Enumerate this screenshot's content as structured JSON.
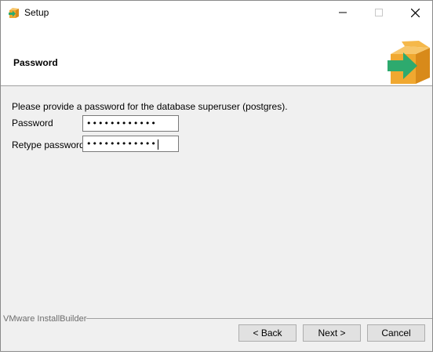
{
  "window": {
    "title": "Setup",
    "icons": [
      "setup-app-icon",
      "minimize-icon",
      "maximize-icon",
      "close-icon"
    ]
  },
  "header": {
    "title": "Password",
    "logo_icon": "installer-box-arrow-icon"
  },
  "main": {
    "intro": "Please provide a password for the database superuser (postgres).",
    "fields": [
      {
        "label": "Password",
        "value": "••••••••••••"
      },
      {
        "label": "Retype password",
        "value": "••••••••••••"
      }
    ]
  },
  "footer": {
    "brand": "VMware InstallBuilder",
    "buttons": {
      "back": "< Back",
      "next": "Next >",
      "cancel": "Cancel"
    }
  },
  "colors": {
    "logo_orange": "#f0a830",
    "logo_green": "#2daa6e",
    "window_bg": "#f0f0f0"
  }
}
